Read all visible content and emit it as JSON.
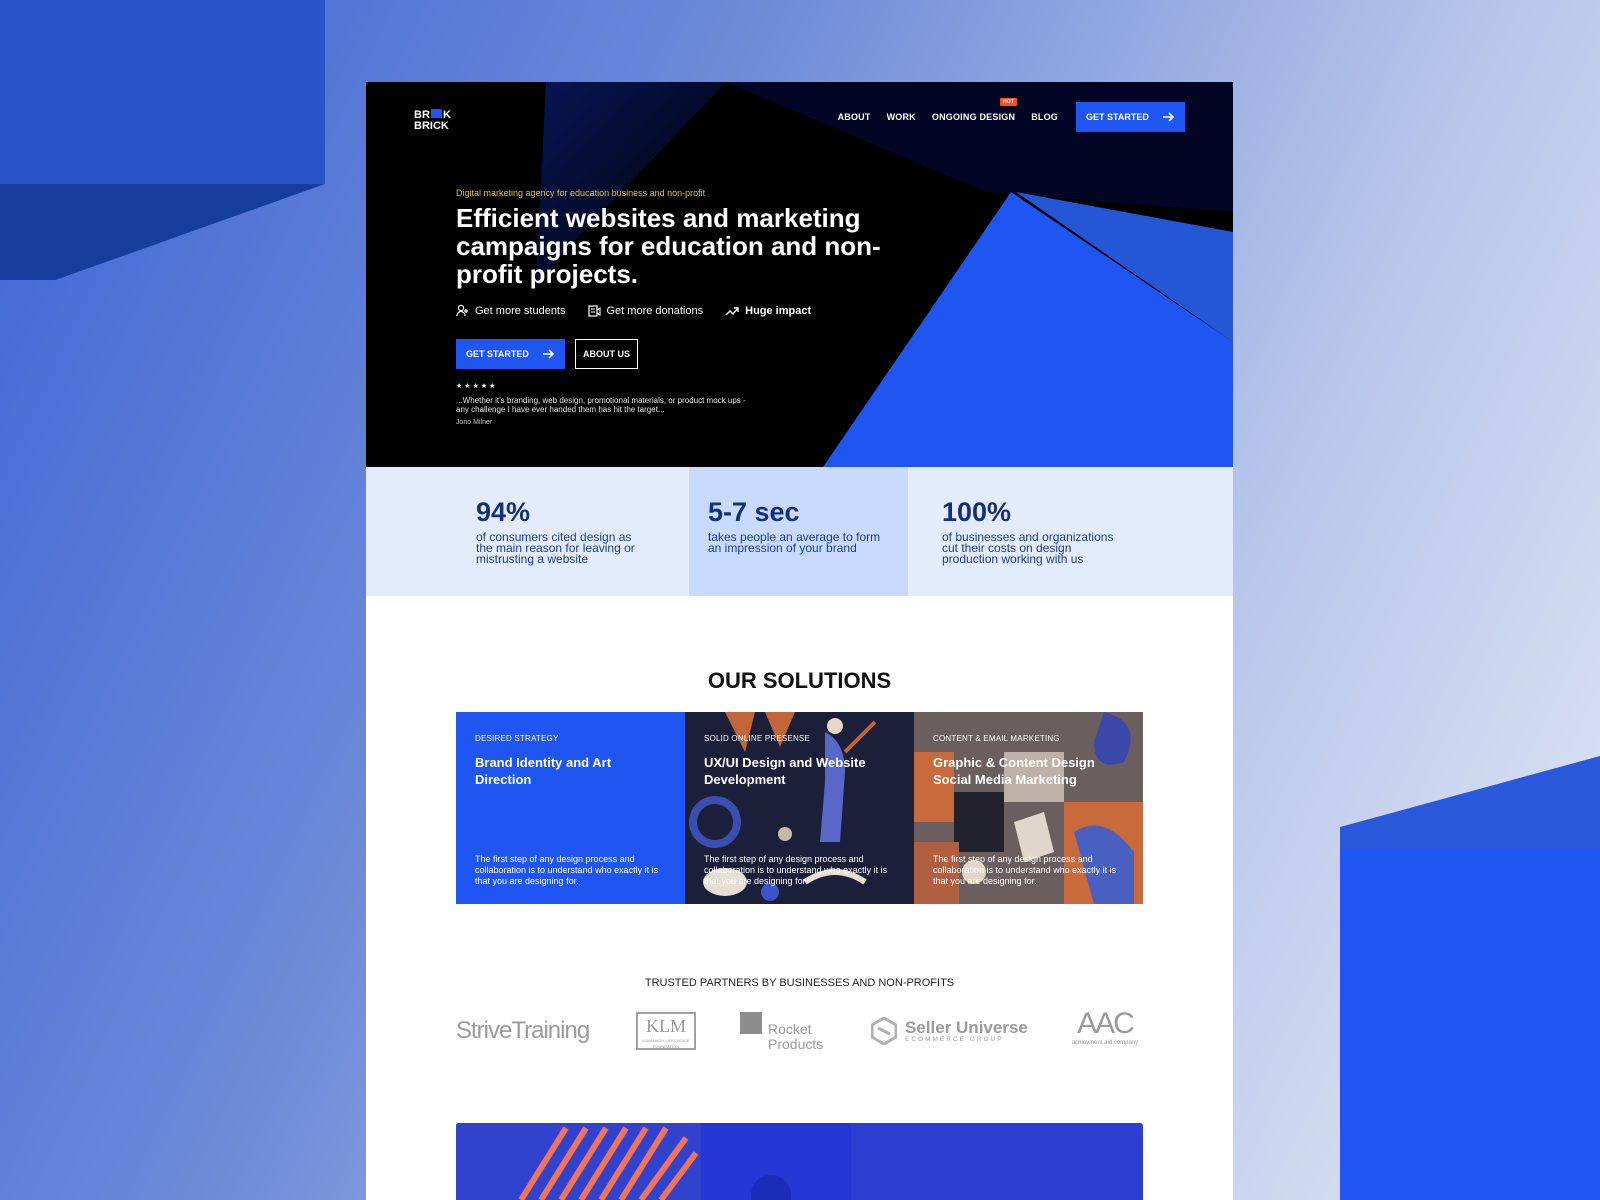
{
  "brand": {
    "logo_line1": "BR",
    "logo_line1_end": "K",
    "logo_line2": "BRICK",
    "accent": "#1f55f0",
    "yellow": "#e6c433"
  },
  "nav": {
    "items": [
      "ABOUT",
      "WORK",
      "ONGOING DESIGN",
      "BLOG"
    ],
    "hot_badge": "HOT",
    "cta": "GET STARTED"
  },
  "hero": {
    "tagline": "Digital marketing agency for education business and non-profit",
    "headline": "Efficient websites and marketing campaigns for education and non-profit projects.",
    "features": [
      {
        "icon": "user-add-icon",
        "label": "Get more students"
      },
      {
        "icon": "donation-icon",
        "label": "Get more donations"
      },
      {
        "icon": "trending-up-icon",
        "label": "Huge impact"
      }
    ],
    "primary_button": "GET STARTED",
    "secondary_button": "ABOUT US",
    "stars": "★★★★★",
    "quote": "...Whether it's branding, web design, promotional materials, or product mock ups - any challenge I have ever handed them has hit the target...",
    "author": "Jono Milner"
  },
  "stats": [
    {
      "value": "94%",
      "text": "of consumers cited design as the main reason for leaving or mistrusting a website"
    },
    {
      "value": "5-7 sec",
      "text": "takes people an average to form an impression of your brand"
    },
    {
      "value": "100%",
      "text": "of businesses and organizations cut their costs on design production working with us"
    }
  ],
  "solutions": {
    "title": "OUR SOLUTIONS",
    "cards": [
      {
        "eyebrow": "DESIRED STRATEGY",
        "title": "Brand Identity and Art Direction",
        "desc": "The first step of any design process and collaboration is to understand who exactly it is that you are designing for."
      },
      {
        "eyebrow": "SOLID ONLINE PRESENSE",
        "title": "UX/UI Design and Website Development",
        "desc": "The first step of any design process and collaboration is to understand who exactly it is that you are designing for."
      },
      {
        "eyebrow": "CONTENT & EMAIL MARKETING",
        "title": "Graphic & Content Design Social Media Marketing",
        "desc": "The first step of any design process and collaboration is to understand who exactly it is that you are designing for."
      }
    ]
  },
  "partners": {
    "title": "TRUSTED PARTNERS BY BUSINESSES AND NON-PROFITS",
    "strive": "StriveTraining",
    "klm": {
      "big": "KLM",
      "small": "KAVANAGH LIFECHOICE FOUNDATION"
    },
    "rocket": {
      "line1": "Rocket",
      "line2": "Products"
    },
    "seller": {
      "name": "Seller Universe",
      "sub": "ECOMMERCE GROUP"
    },
    "aac": {
      "big": "AAC",
      "sub": "achievment aid company"
    }
  }
}
